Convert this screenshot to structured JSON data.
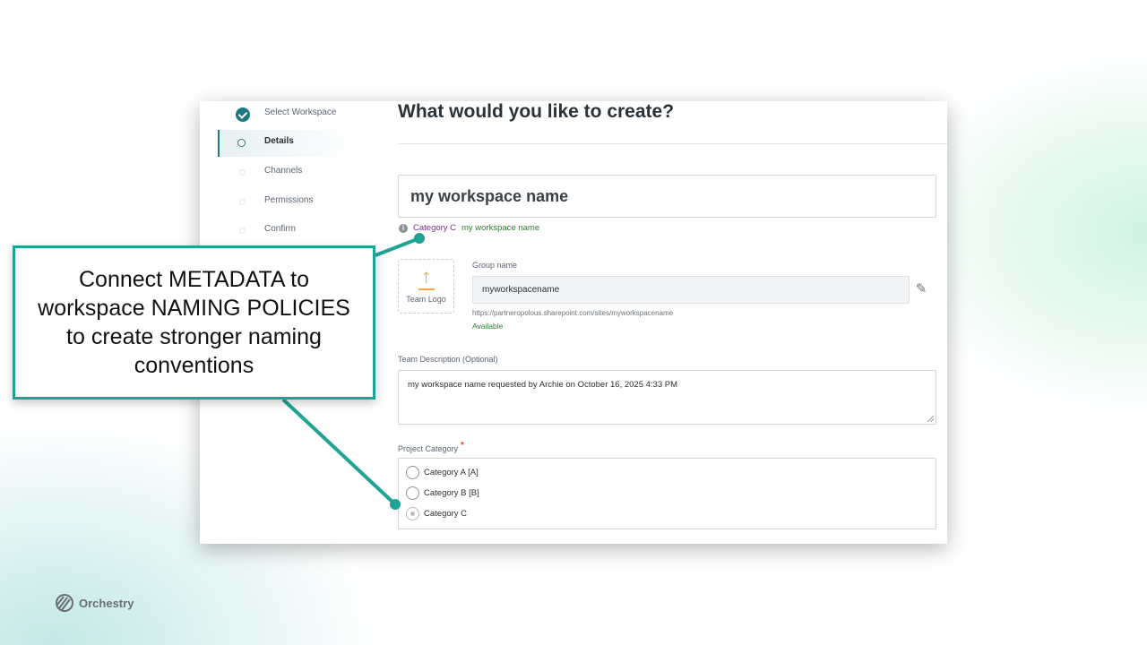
{
  "stepper": {
    "steps": [
      {
        "label": "Select Workspace",
        "state": "done"
      },
      {
        "label": "Details",
        "state": "active"
      },
      {
        "label": "Channels",
        "state": "todo"
      },
      {
        "label": "Permissions",
        "state": "todo"
      },
      {
        "label": "Confirm",
        "state": "todo"
      }
    ]
  },
  "form": {
    "title": "What would you like to create?",
    "workspace_name": "my workspace name",
    "metadata_hint": {
      "category": "Category C",
      "name": "my workspace name"
    },
    "team_logo_label": "Team Logo",
    "group_name": {
      "label": "Group name",
      "value": "myworkspacename",
      "url": "https://partneropolous.sharepoint.com/sites/myworkspacename",
      "status": "Available"
    },
    "description": {
      "label": "Team Description (Optional)",
      "value": "my workspace name requested by Archie on October 16, 2025 4:33 PM"
    },
    "project_category": {
      "label": "Project Category",
      "required_mark": "*",
      "options": [
        {
          "label": "Category A [A]",
          "checked": false
        },
        {
          "label": "Category B [B]",
          "checked": false
        },
        {
          "label": "Category C",
          "checked": true
        }
      ]
    }
  },
  "callout": {
    "text": "Connect METADATA to workspace NAMING POLICIES to create stronger naming conventions",
    "color": "#1fa394"
  },
  "brand": {
    "name": "Orchestry"
  },
  "colors": {
    "accent": "#1b7a80",
    "available": "#2e7d32",
    "category": "#7a2e86"
  }
}
